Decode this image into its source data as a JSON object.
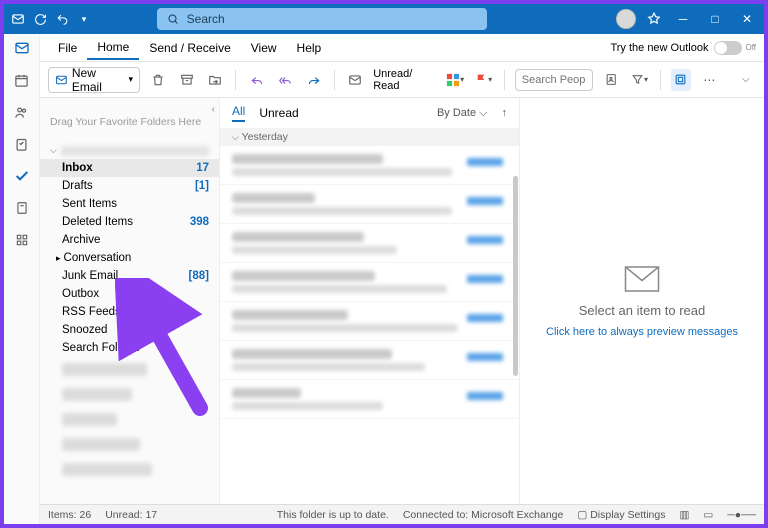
{
  "titlebar": {
    "search_placeholder": "Search"
  },
  "menubar": {
    "tabs": [
      "File",
      "Home",
      "Send / Receive",
      "View",
      "Help"
    ],
    "try_new": "Try the new Outlook",
    "toggle_state": "Off"
  },
  "ribbon": {
    "new_email": "New Email",
    "unread_read": "Unread/ Read",
    "search_people_placeholder": "Search People"
  },
  "folders": {
    "fav_hint": "Drag Your Favorite Folders Here",
    "items": [
      {
        "name": "Inbox",
        "count": "17",
        "selected": true
      },
      {
        "name": "Drafts",
        "count": "[1]"
      },
      {
        "name": "Sent Items",
        "count": ""
      },
      {
        "name": "Deleted Items",
        "count": "398"
      },
      {
        "name": "Archive",
        "count": ""
      },
      {
        "name": "Conversation",
        "count": "",
        "expandable": true
      },
      {
        "name": "Junk Email",
        "count": "[88]"
      },
      {
        "name": "Outbox",
        "count": ""
      },
      {
        "name": "RSS Feeds",
        "count": ""
      },
      {
        "name": "Snoozed",
        "count": ""
      },
      {
        "name": "Search Folders",
        "count": ""
      }
    ]
  },
  "list": {
    "filters": [
      "All",
      "Unread"
    ],
    "sort": "By Date",
    "group": "Yesterday"
  },
  "preview": {
    "title": "Select an item to read",
    "link": "Click here to always preview messages"
  },
  "status": {
    "items": "Items: 26",
    "unread": "Unread: 17",
    "uptodate": "This folder is up to date.",
    "connected": "Connected to: Microsoft Exchange",
    "display": "Display Settings"
  }
}
